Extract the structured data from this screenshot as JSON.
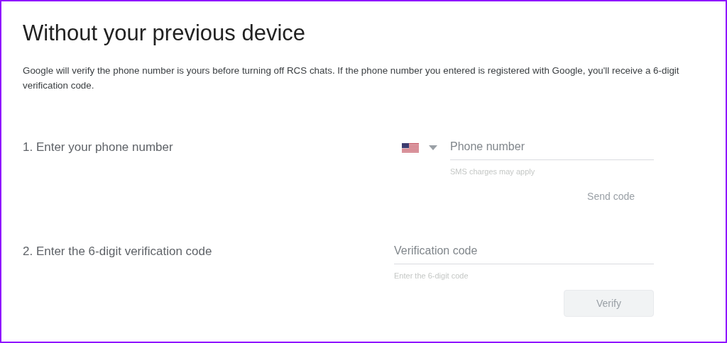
{
  "title": "Without your previous device",
  "description": "Google will verify the phone number is yours before turning off RCS chats. If the phone number you entered is registered with Google, you'll receive a 6-digit verification code.",
  "steps": [
    {
      "label": "1. Enter your phone number",
      "country_picker": true,
      "field": {
        "placeholder": "Phone number"
      },
      "hint": "SMS charges may apply",
      "button": {
        "label": "Send code",
        "kind": "text",
        "disabled": true
      }
    },
    {
      "label": "2. Enter the 6-digit verification code",
      "country_picker": false,
      "field": {
        "placeholder": "Verification code"
      },
      "hint": "Enter the 6-digit code",
      "button": {
        "label": "Verify",
        "kind": "filled",
        "disabled": true
      }
    }
  ]
}
